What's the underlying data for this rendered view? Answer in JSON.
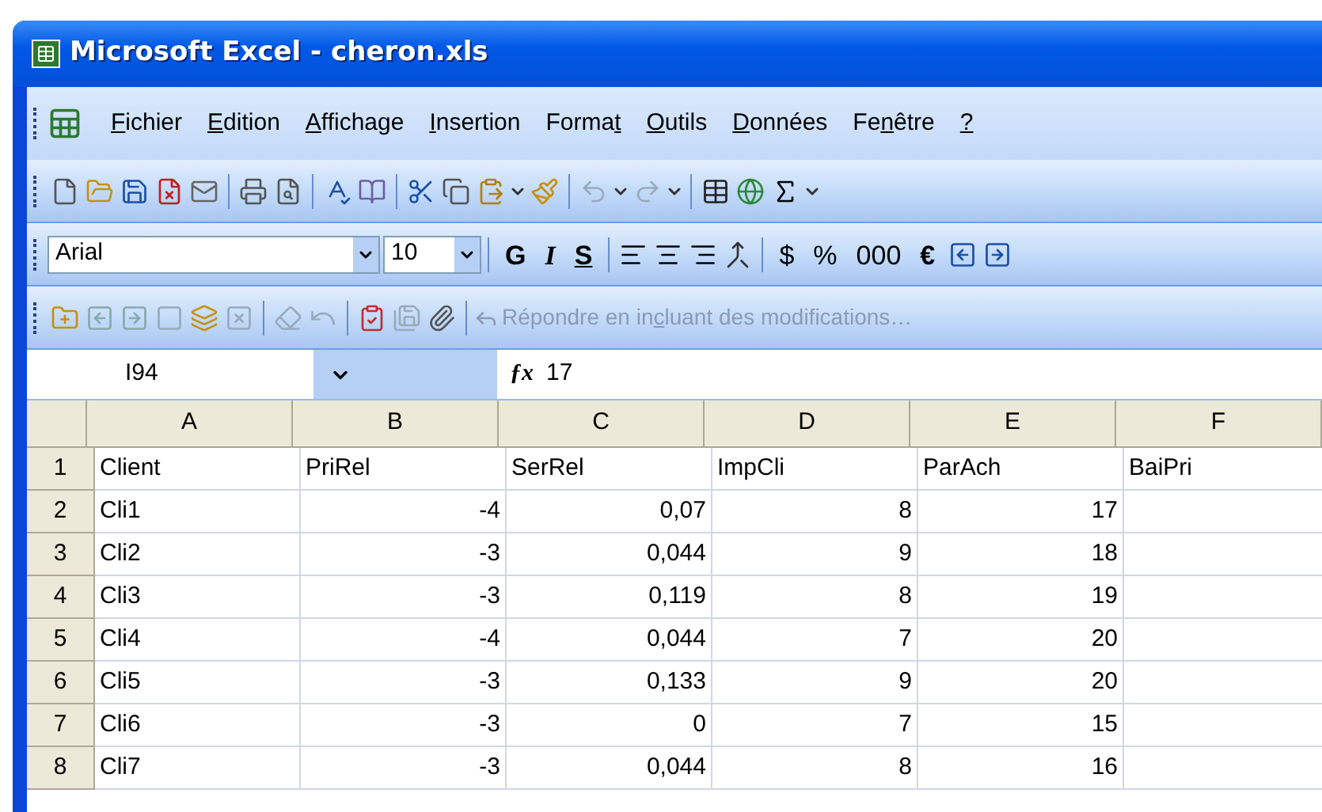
{
  "window": {
    "title": "Microsoft Excel - cheron.xls"
  },
  "menu": [
    {
      "key": "F",
      "after": "ichier"
    },
    {
      "key": "E",
      "after": "dition"
    },
    {
      "key": "A",
      "after": "ffichage"
    },
    {
      "key": "I",
      "after": "nsertion"
    },
    {
      "before": "Forma",
      "key": "t"
    },
    {
      "key": "O",
      "after": "utils"
    },
    {
      "key": "D",
      "after": "onnées"
    },
    {
      "before": "Fe",
      "key": "n",
      "after": "être"
    },
    {
      "key": "?"
    }
  ],
  "format_toolbar": {
    "font": "Arial",
    "size": "10",
    "buttons": [
      {
        "label": "G",
        "kind": "bold"
      },
      {
        "label": "I",
        "kind": "italic"
      },
      {
        "label": "S",
        "kind": "underline"
      },
      {
        "label": "$",
        "kind": "plain"
      },
      {
        "label": "%",
        "kind": "plain"
      },
      {
        "label": "000",
        "kind": "plain"
      },
      {
        "label": "€",
        "kind": "bold"
      }
    ]
  },
  "review_toolbar": {
    "reply_button": {
      "before": "Répondre en in",
      "key": "c",
      "after": "luant des modifications…",
      "disabled": true
    }
  },
  "formula_bar": {
    "name_box": "I94",
    "function_label": "ƒx",
    "formula": "17"
  },
  "sheet": {
    "columns": [
      "A",
      "B",
      "C",
      "D",
      "E",
      "F"
    ],
    "rows": [
      {
        "number": "1",
        "kind": "header",
        "cells": [
          "Client",
          "PriRel",
          "SerRel",
          "ImpCli",
          "ParAch",
          "BaiPri"
        ]
      },
      {
        "number": "2",
        "kind": "data",
        "cells": [
          "Cli1",
          "-4",
          "0,07",
          "8",
          "17"
        ]
      },
      {
        "number": "3",
        "kind": "data",
        "cells": [
          "Cli2",
          "-3",
          "0,044",
          "9",
          "18"
        ]
      },
      {
        "number": "4",
        "kind": "data",
        "cells": [
          "Cli3",
          "-3",
          "0,119",
          "8",
          "19"
        ]
      },
      {
        "number": "5",
        "kind": "data",
        "cells": [
          "Cli4",
          "-4",
          "0,044",
          "7",
          "20"
        ]
      },
      {
        "number": "6",
        "kind": "data",
        "cells": [
          "Cli5",
          "-3",
          "0,133",
          "9",
          "20"
        ]
      },
      {
        "number": "7",
        "kind": "data",
        "cells": [
          "Cli6",
          "-3",
          "0",
          "7",
          "15"
        ]
      },
      {
        "number": "8",
        "kind": "data",
        "cells": [
          "Cli7",
          "-3",
          "0,044",
          "8",
          "16"
        ]
      }
    ]
  }
}
